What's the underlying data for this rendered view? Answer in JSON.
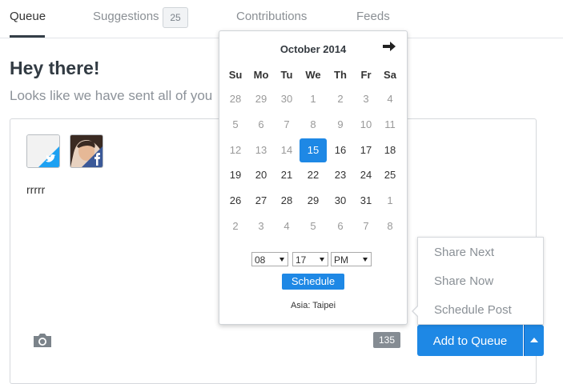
{
  "tabs": [
    {
      "label": "Queue",
      "active": true
    },
    {
      "label": "Suggestions",
      "badge": "25"
    },
    {
      "label": "Contributions"
    },
    {
      "label": "Feeds"
    }
  ],
  "heading": "Hey there!",
  "subtitle": "Looks like we have sent all of you",
  "composer": {
    "text": "rrrrr",
    "profiles": [
      {
        "network": "twitter",
        "icon": "twitter-icon"
      },
      {
        "network": "facebook",
        "icon": "facebook-icon"
      }
    ],
    "char_count": "135",
    "add_button": "Add to Queue",
    "dropup_items": [
      "Share Next",
      "Share Now",
      "Schedule Post"
    ]
  },
  "datepicker": {
    "title": "October 2014",
    "weekdays": [
      "Su",
      "Mo",
      "Tu",
      "We",
      "Th",
      "Fr",
      "Sa"
    ],
    "weeks": [
      [
        "28",
        "29",
        "30",
        "1",
        "2",
        "3",
        "4"
      ],
      [
        "5",
        "6",
        "7",
        "8",
        "9",
        "10",
        "11"
      ],
      [
        "12",
        "13",
        "14",
        "15",
        "16",
        "17",
        "18"
      ],
      [
        "19",
        "20",
        "21",
        "22",
        "23",
        "24",
        "25"
      ],
      [
        "26",
        "27",
        "28",
        "29",
        "30",
        "31",
        "1"
      ],
      [
        "2",
        "3",
        "4",
        "5",
        "6",
        "7",
        "8"
      ]
    ],
    "selected_day": "15",
    "hour": "08",
    "minute": "17",
    "ampm": "PM",
    "schedule_label": "Schedule",
    "timezone": "Asia: Taipei"
  },
  "colors": {
    "accent": "#1e88e5",
    "twitter": "#1da1f2",
    "facebook": "#3b5998"
  }
}
